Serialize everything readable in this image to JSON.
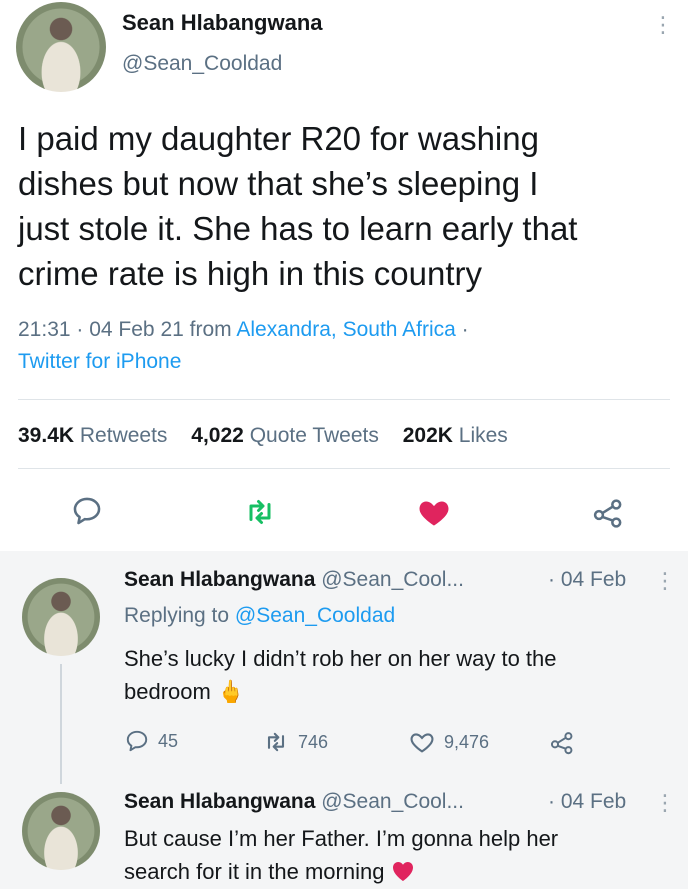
{
  "tweet": {
    "author_name": "Sean Hlabangwana",
    "handle": "@Sean_Cooldad",
    "text_lines": [
      "I paid my daughter R20 for washing",
      "dishes but now that she’s sleeping I",
      "just stole it. She has to learn early that",
      "crime rate is high in this country"
    ],
    "time": "21:31",
    "date": "04 Feb 21",
    "from_word": "from",
    "location": "Alexandra, South Africa",
    "source": "Twitter for iPhone",
    "stats": {
      "retweets_value": "39.4K",
      "retweets_label": "Retweets",
      "quotes_value": "4,022",
      "quotes_label": "Quote Tweets",
      "likes_value": "202K",
      "likes_label": "Likes"
    },
    "icons": [
      "comment-icon",
      "retweet-icon",
      "heart-filled-icon",
      "share-icon"
    ]
  },
  "replies": [
    {
      "author_name": "Sean Hlabangwana",
      "handle": "@Sean_Cool...",
      "date": "· 04 Feb",
      "replying_label": "Replying to",
      "replying_to": "@Sean_Cooldad",
      "text_lines": [
        "She’s lucky I didn’t rob her on her way to the",
        "bedroom"
      ],
      "emoji": "middle-finger-emoji",
      "counts": {
        "replies": "45",
        "retweets": "746",
        "likes": "9,476"
      }
    },
    {
      "author_name": "Sean Hlabangwana",
      "handle": "@Sean_Cool...",
      "date": "· 04 Feb",
      "text_lines": [
        "But cause I’m her Father. I’m gonna help her",
        "search for it in the morning"
      ],
      "emoji": "red-heart-emoji"
    }
  ],
  "colors": {
    "link": "#1d9bf0",
    "muted": "#5b7083",
    "like": "#e0245e",
    "retweet": "#17bf63"
  }
}
